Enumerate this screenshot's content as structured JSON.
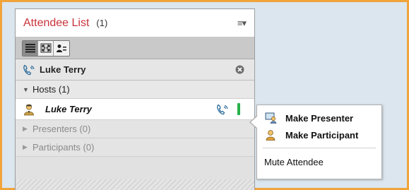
{
  "pod": {
    "title": "Attendee List",
    "count": "(1)",
    "menu_glyph": "≡▾"
  },
  "toolbar": {
    "buttons": [
      {
        "icon": "list-view-icon",
        "active": true
      },
      {
        "icon": "expand-view-icon",
        "active": false
      },
      {
        "icon": "attendee-roles-icon",
        "active": false
      }
    ]
  },
  "search": {
    "icon": "phone-icon",
    "value": "Luke Terry",
    "clear_icon": "clear-circle-icon"
  },
  "groups": [
    {
      "label": "Hosts (1)",
      "expanded": true
    },
    {
      "label": "Presenters (0)",
      "expanded": false
    },
    {
      "label": "Participants (0)",
      "expanded": false
    }
  ],
  "attendee": {
    "name": "Luke Terry",
    "role_icon": "host-user-icon",
    "audio_icon": "phone-icon",
    "status_color": "#27b14a"
  },
  "context_menu": {
    "items": [
      {
        "label": "Make Presenter",
        "icon": "presenter-icon"
      },
      {
        "label": "Make Participant",
        "icon": "participant-icon"
      }
    ],
    "mute_label": "Mute Attendee"
  },
  "colors": {
    "accent_border": "#f0a43a",
    "title_red": "#c8323a"
  }
}
